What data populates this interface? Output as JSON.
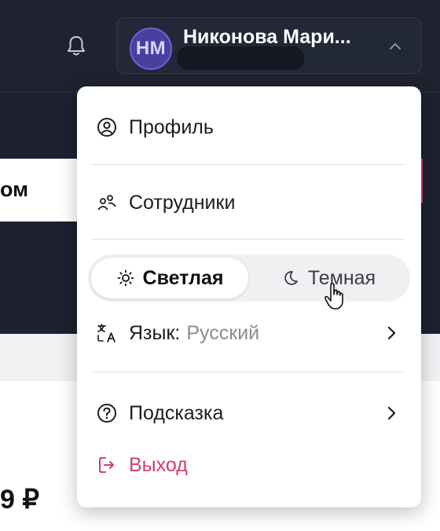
{
  "header": {
    "user": {
      "initials": "НМ",
      "name": "Никонова Мари..."
    }
  },
  "background": {
    "partial_label": "ом",
    "partial_price": "9 ₽"
  },
  "menu": {
    "profile_label": "Профиль",
    "employees_label": "Сотрудники",
    "theme": {
      "light_label": "Светлая",
      "dark_label": "Темная",
      "selected": "light"
    },
    "language": {
      "label": "Язык:",
      "value": "Русский"
    },
    "hint_label": "Подсказка",
    "logout_label": "Выход"
  },
  "colors": {
    "accent_logout": "#d63a72",
    "avatar_bg": "#4b3f9e",
    "topbar_bg": "#1f2330"
  },
  "icons": {
    "bell": "bell-icon",
    "profile": "user-circle-icon",
    "employees": "users-icon",
    "light_theme": "sun-icon",
    "dark_theme": "moon-icon",
    "language": "translate-icon",
    "hint": "question-circle-icon",
    "logout": "logout-icon"
  }
}
